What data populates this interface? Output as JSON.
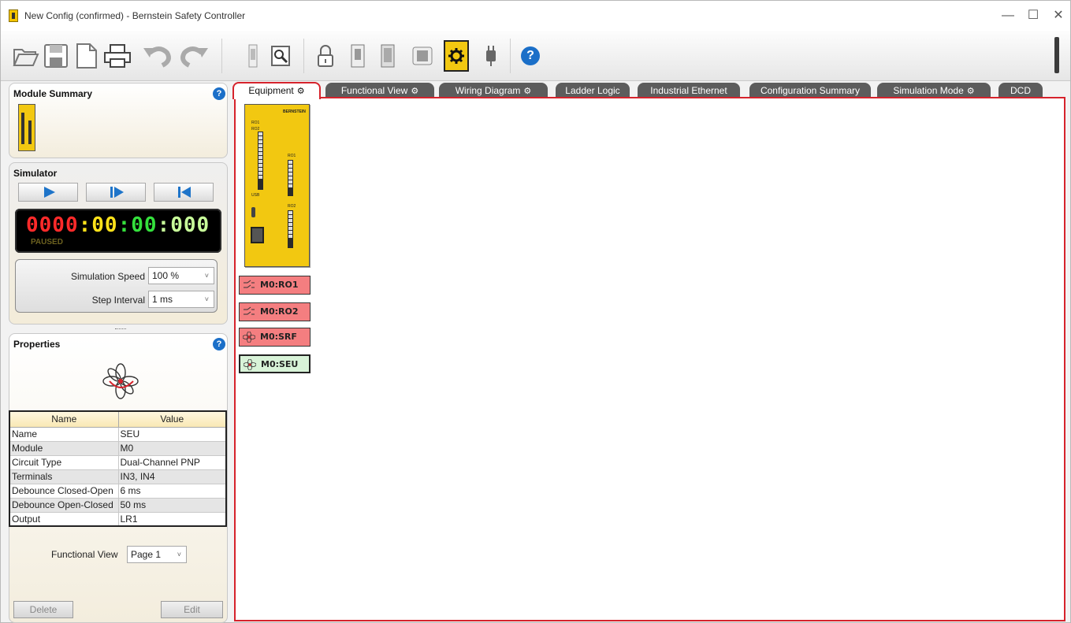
{
  "window": {
    "title": "New Config (confirmed) - Bernstein Safety Controller",
    "minimize": "—",
    "maximize": "☐",
    "close": "✕"
  },
  "toolbar": {
    "items": [
      "open-icon",
      "save-icon",
      "new-icon",
      "print-icon",
      "undo-icon",
      "redo-icon",
      "module-icon",
      "inspect-icon",
      "lock-icon",
      "controller-icon",
      "controller-config-icon",
      "chip-icon",
      "settings-gear-icon",
      "plug-icon",
      "help-icon"
    ]
  },
  "module_summary": {
    "title": "Module Summary",
    "help": "?"
  },
  "simulator": {
    "title": "Simulator",
    "counter": "0000",
    "hours": "00",
    "minutes": "00",
    "millis": "000",
    "sep": ":",
    "status": "PAUSED",
    "speed_label": "Simulation Speed",
    "speed_value": "100 %",
    "step_label": "Step Interval",
    "step_value": "1 ms",
    "dropdown_arrow": "˅"
  },
  "properties": {
    "title": "Properties",
    "help": "?",
    "columns": [
      "Name",
      "Value"
    ],
    "rows": [
      [
        "Name",
        "SEU"
      ],
      [
        "Module",
        "M0"
      ],
      [
        "Circuit Type",
        "Dual-Channel PNP"
      ],
      [
        "Terminals",
        "IN3, IN4"
      ],
      [
        "Debounce Closed-Open",
        "6 ms"
      ],
      [
        "Debounce Open-Closed",
        "50 ms"
      ],
      [
        "Output",
        "LR1"
      ]
    ],
    "functional_view_label": "Functional View",
    "functional_view_value": "Page 1",
    "delete_label": "Delete",
    "edit_label": "Edit"
  },
  "tabs": [
    {
      "label": "Equipment",
      "gear": true
    },
    {
      "label": "Functional View",
      "gear": true
    },
    {
      "label": "Wiring Diagram",
      "gear": true
    },
    {
      "label": "Ladder Logic",
      "gear": false
    },
    {
      "label": "Industrial Ethernet",
      "gear": false
    },
    {
      "label": "Configuration Summary",
      "gear": false
    },
    {
      "label": "Simulation Mode",
      "gear": true
    },
    {
      "label": "DCD",
      "gear": false
    }
  ],
  "gear_glyph": "⚙",
  "device": {
    "brand": "BERNSTEIN",
    "ro1": "RO1",
    "ro2": "RO2",
    "usb": "USB",
    "ro1_right": "RO1",
    "ro2_right": "RO2"
  },
  "blocks": [
    {
      "label": "M0:RO1",
      "state": "red",
      "icon": "relay-output-icon"
    },
    {
      "label": "M0:RO2",
      "state": "red",
      "icon": "relay-output-icon"
    },
    {
      "label": "M0:SRF",
      "state": "red",
      "icon": "safety-function-icon"
    },
    {
      "label": "M0:SEU",
      "state": "green",
      "icon": "safety-function-icon"
    }
  ],
  "colors": {
    "accent_red": "#d6232c",
    "counter_red": "#ff2a2a",
    "hours_yellow": "#ffe21a",
    "minutes_green": "#34e03c",
    "millis_green": "#c8ff9a"
  }
}
